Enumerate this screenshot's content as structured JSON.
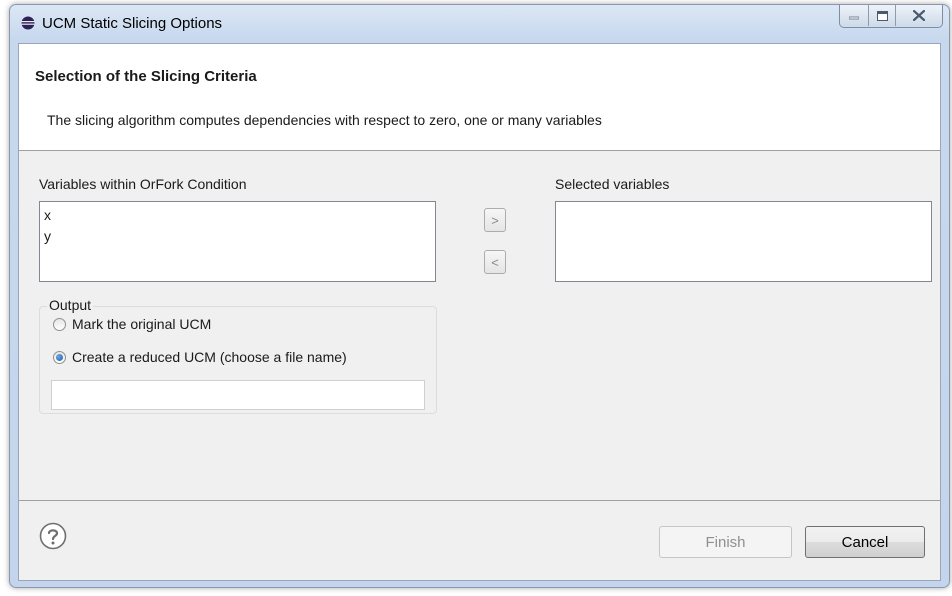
{
  "window": {
    "title": "UCM Static Slicing Options"
  },
  "header": {
    "title": "Selection of the Slicing Criteria",
    "description": "The slicing algorithm computes dependencies with respect to zero, one or many variables"
  },
  "variables": {
    "label": "Variables within OrFork Condition",
    "items": [
      "x",
      "y"
    ]
  },
  "selected": {
    "label": "Selected variables",
    "items": []
  },
  "transfer": {
    "add_label": ">",
    "remove_label": "<"
  },
  "output": {
    "label": "Output",
    "options": [
      {
        "label": "Mark the original UCM",
        "checked": false
      },
      {
        "label": "Create a reduced UCM (choose a file name)",
        "checked": true
      }
    ],
    "filename_value": ""
  },
  "footer": {
    "finish_label": "Finish",
    "cancel_label": "Cancel",
    "finish_enabled": false
  },
  "icons": {
    "app": "eclipse-icon",
    "help": "help-icon",
    "minimize": "minimize-icon",
    "maximize": "maximize-icon",
    "close": "close-icon"
  }
}
